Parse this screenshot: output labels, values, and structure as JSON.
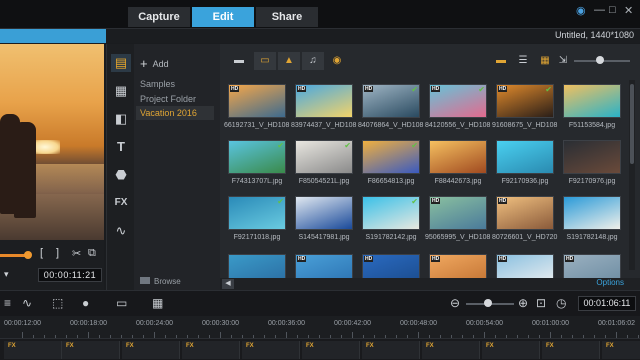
{
  "tabs": [
    {
      "label": "Capture",
      "active": false
    },
    {
      "label": "Edit",
      "active": true
    },
    {
      "label": "Share",
      "active": false
    }
  ],
  "window_controls": [
    "help-icon",
    "minimize-icon",
    "restore-icon",
    "close-icon"
  ],
  "project_title": "Untitled, 1440*1080",
  "preview": {
    "timecode": "00:00:11:21"
  },
  "folders": {
    "add_label": "Add",
    "items": [
      {
        "label": "Samples",
        "selected": false
      },
      {
        "label": "Project Folder",
        "selected": false
      },
      {
        "label": "Vacation 2016",
        "selected": true
      }
    ],
    "browse_label": "Browse"
  },
  "library": {
    "toolbar_icons": [
      "folder-icon",
      "video-filter-icon",
      "photo-filter-icon",
      "music-filter-icon",
      "sticker-icon"
    ],
    "view_icons": [
      "thumbnail-view-icon",
      "list-view-icon",
      "grid-view-icon",
      "import-icon"
    ],
    "thumbnails": [
      {
        "label": "66192731_V_HD108...",
        "hd": true,
        "checked": false,
        "colors": [
          "#f5a74a",
          "#3d6a8e"
        ]
      },
      {
        "label": "83974437_V_HD108...",
        "hd": true,
        "checked": false,
        "colors": [
          "#4aa8e0",
          "#f2d36a"
        ]
      },
      {
        "label": "84076864_V_HD108...",
        "hd": true,
        "checked": true,
        "colors": [
          "#9fb5c4",
          "#2a4a60"
        ]
      },
      {
        "label": "84120556_V_HD108...",
        "hd": true,
        "checked": true,
        "colors": [
          "#66c3d8",
          "#e36a8e"
        ]
      },
      {
        "label": "91608675_V_HD108...",
        "hd": true,
        "checked": true,
        "colors": [
          "#e08a2c",
          "#2a1e18"
        ]
      },
      {
        "label": "F51153584.jpg",
        "hd": false,
        "checked": false,
        "colors": [
          "#f0c060",
          "#2ab2c8"
        ]
      },
      {
        "label": "F74313707L.jpg",
        "hd": false,
        "checked": true,
        "colors": [
          "#5ac4e0",
          "#3a8a4a"
        ]
      },
      {
        "label": "F85054521L.jpg",
        "hd": false,
        "checked": true,
        "colors": [
          "#e8e6e0",
          "#8a8a8a"
        ]
      },
      {
        "label": "F86654813.jpg",
        "hd": false,
        "checked": true,
        "colors": [
          "#f0b040",
          "#3a5ac0"
        ]
      },
      {
        "label": "F88442673.jpg",
        "hd": false,
        "checked": false,
        "colors": [
          "#f5c060",
          "#a04a20"
        ]
      },
      {
        "label": "F92170936.jpg",
        "hd": false,
        "checked": false,
        "colors": [
          "#4ad0f0",
          "#2a8ab0"
        ]
      },
      {
        "label": "F92170976.jpg",
        "hd": false,
        "checked": false,
        "colors": [
          "#2a2e34",
          "#6a4a3a"
        ]
      },
      {
        "label": "F92171018.jpg",
        "hd": false,
        "checked": true,
        "colors": [
          "#2a8ab8",
          "#6acbe0"
        ]
      },
      {
        "label": "S145417981.jpg",
        "hd": false,
        "checked": false,
        "colors": [
          "#e0e8f0",
          "#1a4a9a"
        ]
      },
      {
        "label": "S191782142.jpg",
        "hd": false,
        "checked": true,
        "colors": [
          "#3ac0e8",
          "#e8e8e0"
        ]
      },
      {
        "label": "95065995_V_HD108...",
        "hd": true,
        "checked": false,
        "colors": [
          "#8ac0a0",
          "#4a7a9a"
        ]
      },
      {
        "label": "80726601_V_HD720...",
        "hd": true,
        "checked": false,
        "colors": [
          "#f0c080",
          "#8a5a3a"
        ]
      },
      {
        "label": "S191782148.jpg",
        "hd": false,
        "checked": false,
        "colors": [
          "#2a9ad8",
          "#f0f0ea"
        ]
      },
      {
        "label": "",
        "hd": false,
        "checked": false,
        "colors": [
          "#3a9ac8",
          "#2a6aa0"
        ]
      },
      {
        "label": "",
        "hd": true,
        "checked": false,
        "colors": [
          "#4aa0d8",
          "#2a70b0"
        ]
      },
      {
        "label": "",
        "hd": true,
        "checked": false,
        "colors": [
          "#2a6ac0",
          "#1a4a8a"
        ]
      },
      {
        "label": "",
        "hd": true,
        "checked": false,
        "colors": [
          "#f0a860",
          "#c07030"
        ]
      },
      {
        "label": "",
        "hd": true,
        "checked": false,
        "colors": [
          "#8ac0e0",
          "#f0f0f0"
        ]
      },
      {
        "label": "",
        "hd": true,
        "checked": false,
        "colors": [
          "#9ab0c0",
          "#6a8aa0"
        ]
      }
    ],
    "options_label": "Options"
  },
  "timeline": {
    "timecode": "00:01:06:11",
    "ruler": [
      "00:00:12:00",
      "00:00:18:00",
      "00:00:24:00",
      "00:00:30:00",
      "00:00:36:00",
      "00:00:42:00",
      "00:00:48:00",
      "00:00:54:00",
      "00:01:00:00",
      "00:01:06:02"
    ],
    "fx_label": "FX"
  },
  "colors": {
    "accent": "#3aa3dc",
    "highlight": "#e0a534",
    "check": "#62c046"
  }
}
